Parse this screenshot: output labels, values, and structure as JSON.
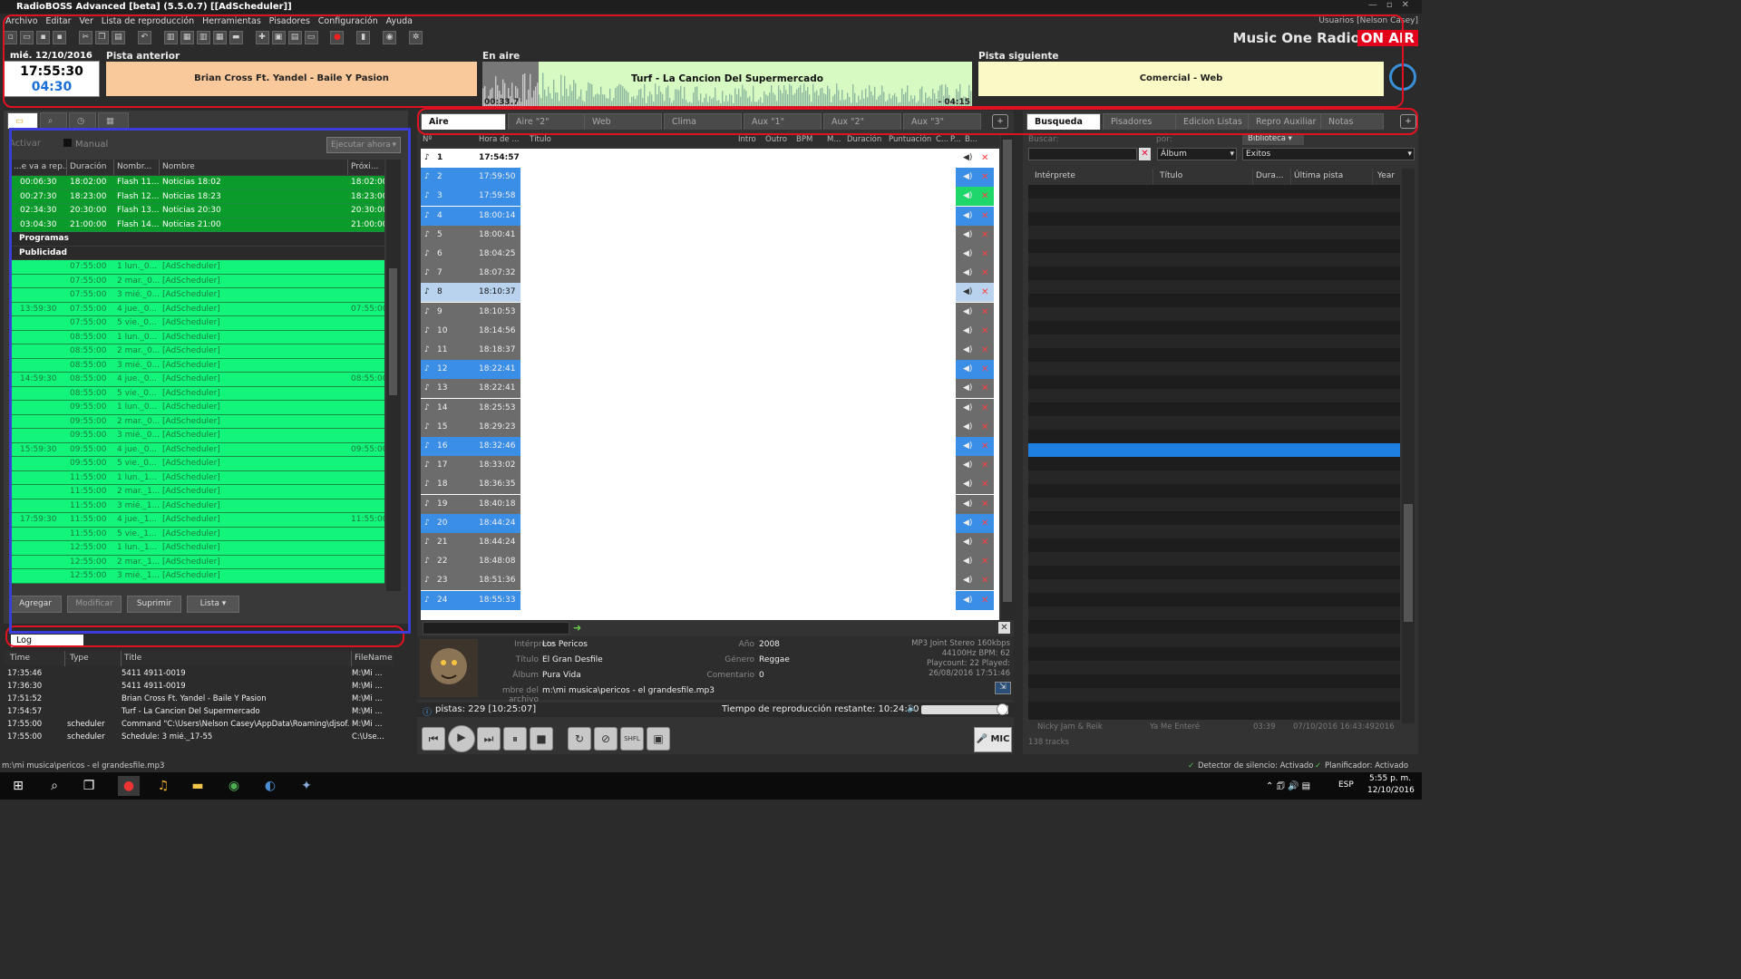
{
  "app": {
    "title": "RadioBOSS Advanced [beta] (5.5.0.7) [[AdScheduler]]",
    "users": "Usuarios [Nelson Casey]",
    "station_name": "Music One Radio",
    "on_air_label": "ON AIR"
  },
  "menu": [
    "Archivo",
    "Editar",
    "Ver",
    "Lista de reproducción",
    "Herramientas",
    "Pisadores",
    "Configuración",
    "Ayuda"
  ],
  "status": {
    "date": "mié. 12/10/2016",
    "time": "17:55:30",
    "countdown": "04:30",
    "prev_label": "Pista anterior",
    "prev_track": "Brian Cross Ft. Yandel - Baile Y Pasion",
    "onair_label": "En aire",
    "onair_track": "Turf - La Cancion Del Supermercado",
    "onair_elapsed": "00:33.7",
    "onair_remaining": "- 04:15",
    "next_label": "Pista siguiente",
    "next_track": "Comercial - Web"
  },
  "scheduler": {
    "activar": "Activar",
    "manual": "Manual",
    "run_now": "Ejecutar ahora",
    "columns": [
      "...e va a rep...",
      "Duración",
      "Nombr...",
      "Nombre",
      "Próxi..."
    ],
    "rows": [
      {
        "kind": "dark",
        "c1": "00:06:30",
        "c2": "18:02:00",
        "c3": "Flash 11...",
        "c4": "Noticias 18:02",
        "c5": "18:02:00"
      },
      {
        "kind": "dark",
        "c1": "00:27:30",
        "c2": "18:23:00",
        "c3": "Flash 12...",
        "c4": "Noticias 18:23",
        "c5": "18:23:00"
      },
      {
        "kind": "dark",
        "c1": "02:34:30",
        "c2": "20:30:00",
        "c3": "Flash 13...",
        "c4": "Noticias 20:30",
        "c5": "20:30:00"
      },
      {
        "kind": "dark",
        "c1": "03:04:30",
        "c2": "21:00:00",
        "c3": "Flash 14...",
        "c4": "Noticias 21:00",
        "c5": "21:00:00"
      },
      {
        "kind": "group",
        "c1": "Programas"
      },
      {
        "kind": "group",
        "c1": "Publicidad"
      },
      {
        "kind": "light",
        "c1": "",
        "c2": "07:55:00",
        "c3": "1 lun._0...",
        "c4": "[AdScheduler]",
        "c5": ""
      },
      {
        "kind": "light",
        "c1": "",
        "c2": "07:55:00",
        "c3": "2 mar._0...",
        "c4": "[AdScheduler]",
        "c5": ""
      },
      {
        "kind": "light",
        "c1": "",
        "c2": "07:55:00",
        "c3": "3 mié._0...",
        "c4": "[AdScheduler]",
        "c5": ""
      },
      {
        "kind": "light",
        "c1": "13:59:30",
        "c2": "07:55:00",
        "c3": "4 jue._0...",
        "c4": "[AdScheduler]",
        "c5": "07:55:00"
      },
      {
        "kind": "light",
        "c1": "",
        "c2": "07:55:00",
        "c3": "5 vie._0...",
        "c4": "[AdScheduler]",
        "c5": ""
      },
      {
        "kind": "light",
        "c1": "",
        "c2": "08:55:00",
        "c3": "1 lun._0...",
        "c4": "[AdScheduler]",
        "c5": ""
      },
      {
        "kind": "light",
        "c1": "",
        "c2": "08:55:00",
        "c3": "2 mar._0...",
        "c4": "[AdScheduler]",
        "c5": ""
      },
      {
        "kind": "light",
        "c1": "",
        "c2": "08:55:00",
        "c3": "3 mié._0...",
        "c4": "[AdScheduler]",
        "c5": ""
      },
      {
        "kind": "light",
        "c1": "14:59:30",
        "c2": "08:55:00",
        "c3": "4 jue._0...",
        "c4": "[AdScheduler]",
        "c5": "08:55:00"
      },
      {
        "kind": "light",
        "c1": "",
        "c2": "08:55:00",
        "c3": "5 vie._0...",
        "c4": "[AdScheduler]",
        "c5": ""
      },
      {
        "kind": "light",
        "c1": "",
        "c2": "09:55:00",
        "c3": "1 lun._0...",
        "c4": "[AdScheduler]",
        "c5": ""
      },
      {
        "kind": "light",
        "c1": "",
        "c2": "09:55:00",
        "c3": "2 mar._0...",
        "c4": "[AdScheduler]",
        "c5": ""
      },
      {
        "kind": "light",
        "c1": "",
        "c2": "09:55:00",
        "c3": "3 mié._0...",
        "c4": "[AdScheduler]",
        "c5": ""
      },
      {
        "kind": "light",
        "c1": "15:59:30",
        "c2": "09:55:00",
        "c3": "4 jue._0...",
        "c4": "[AdScheduler]",
        "c5": "09:55:00"
      },
      {
        "kind": "light",
        "c1": "",
        "c2": "09:55:00",
        "c3": "5 vie._0...",
        "c4": "[AdScheduler]",
        "c5": ""
      },
      {
        "kind": "light",
        "c1": "",
        "c2": "11:55:00",
        "c3": "1 lun._1...",
        "c4": "[AdScheduler]",
        "c5": ""
      },
      {
        "kind": "light",
        "c1": "",
        "c2": "11:55:00",
        "c3": "2 mar._1...",
        "c4": "[AdScheduler]",
        "c5": ""
      },
      {
        "kind": "light",
        "c1": "",
        "c2": "11:55:00",
        "c3": "3 mié._1...",
        "c4": "[AdScheduler]",
        "c5": ""
      },
      {
        "kind": "light",
        "c1": "17:59:30",
        "c2": "11:55:00",
        "c3": "4 jue._1...",
        "c4": "[AdScheduler]",
        "c5": "11:55:00"
      },
      {
        "kind": "light",
        "c1": "",
        "c2": "11:55:00",
        "c3": "5 vie._1...",
        "c4": "[AdScheduler]",
        "c5": ""
      },
      {
        "kind": "light",
        "c1": "",
        "c2": "12:55:00",
        "c3": "1 lun._1...",
        "c4": "[AdScheduler]",
        "c5": ""
      },
      {
        "kind": "light",
        "c1": "",
        "c2": "12:55:00",
        "c3": "2 mar._1...",
        "c4": "[AdScheduler]",
        "c5": ""
      },
      {
        "kind": "light",
        "c1": "",
        "c2": "12:55:00",
        "c3": "3 mié._1...",
        "c4": "[AdScheduler]",
        "c5": ""
      }
    ],
    "buttons": {
      "add": "Agregar",
      "modify": "Modificar",
      "delete": "Suprimir",
      "list": "Lista"
    }
  },
  "log": {
    "tab": "Log",
    "columns": [
      "Time",
      "Type",
      "Title",
      "FileName"
    ],
    "rows": [
      {
        "time": "17:35:46",
        "type": "",
        "title": "5411 4911-0019",
        "file": "M:\\Mi ..."
      },
      {
        "time": "17:36:30",
        "type": "",
        "title": "5411 4911-0019",
        "file": "M:\\Mi ..."
      },
      {
        "time": "17:51:52",
        "type": "",
        "title": "Brian Cross Ft. Yandel - Baile Y Pasion",
        "file": "M:\\Mi ..."
      },
      {
        "time": "17:54:57",
        "type": "",
        "title": "Turf - La Cancion Del Supermercado",
        "file": "M:\\Mi ..."
      },
      {
        "time": "17:55:00",
        "type": "scheduler",
        "title": "Command \"C:\\Users\\Nelson Casey\\AppData\\Roaming\\djsof...",
        "file": "M:\\Mi ..."
      },
      {
        "time": "17:55:00",
        "type": "scheduler",
        "title": "Schedule: 3 mié._17-55",
        "file": "C:\\Use..."
      }
    ]
  },
  "playlist": {
    "tabs": [
      "Aire",
      "Aire \"2\"",
      "Web",
      "Clima",
      "Aux \"1\"",
      "Aux \"2\"",
      "Aux \"3\""
    ],
    "columns": [
      "Nº",
      "Hora de ...",
      "Título",
      "Intro",
      "Outro",
      "BPM",
      "M...",
      "Duración",
      "Puntuación",
      "C...",
      "P...",
      "B..."
    ],
    "rows": [
      {
        "n": "1",
        "t": "17:54:57",
        "state": "playing"
      },
      {
        "n": "2",
        "t": "17:59:50",
        "state": "blue"
      },
      {
        "n": "3",
        "t": "17:59:58",
        "state": "green"
      },
      {
        "n": "4",
        "t": "18:00:14",
        "state": "blue"
      },
      {
        "n": "5",
        "t": "18:00:41",
        "state": "gray"
      },
      {
        "n": "6",
        "t": "18:04:25",
        "state": "gray"
      },
      {
        "n": "7",
        "t": "18:07:32",
        "state": "gray"
      },
      {
        "n": "8",
        "t": "18:10:37",
        "state": "selected"
      },
      {
        "n": "9",
        "t": "18:10:53",
        "state": "gray"
      },
      {
        "n": "10",
        "t": "18:14:56",
        "state": "gray"
      },
      {
        "n": "11",
        "t": "18:18:37",
        "state": "gray"
      },
      {
        "n": "12",
        "t": "18:22:41",
        "state": "blue"
      },
      {
        "n": "13",
        "t": "18:22:41",
        "state": "gray"
      },
      {
        "n": "14",
        "t": "18:25:53",
        "state": "gray"
      },
      {
        "n": "15",
        "t": "18:29:23",
        "state": "gray"
      },
      {
        "n": "16",
        "t": "18:32:46",
        "state": "blue"
      },
      {
        "n": "17",
        "t": "18:33:02",
        "state": "gray"
      },
      {
        "n": "18",
        "t": "18:36:35",
        "state": "gray"
      },
      {
        "n": "19",
        "t": "18:40:18",
        "state": "gray"
      },
      {
        "n": "20",
        "t": "18:44:24",
        "state": "blue"
      },
      {
        "n": "21",
        "t": "18:44:24",
        "state": "gray"
      },
      {
        "n": "22",
        "t": "18:48:08",
        "state": "gray"
      },
      {
        "n": "23",
        "t": "18:51:36",
        "state": "gray"
      },
      {
        "n": "24",
        "t": "18:55:33",
        "state": "blue"
      }
    ],
    "info": {
      "artist_label": "Intérprete",
      "artist": "Los Pericos",
      "title_label": "Título",
      "title": "El Gran Desfile",
      "album_label": "Álbum",
      "album": "Pura Vida",
      "file_label": "mbre del archivo",
      "file": "m:\\mi musica\\pericos - el grandesfile.mp3",
      "year_label": "Año",
      "year": "2008",
      "genre_label": "Género",
      "genre": "Reggae",
      "comment_label": "Comentario",
      "comment": "0",
      "tech1": "MP3 Joint Stereo 160kbps",
      "tech2": "44100Hz BPM: 62",
      "tech3": "Playcount: 22  Played:",
      "tech4": "26/08/2016 17:51:46"
    },
    "tracks": "pistas: 229 [10:25:07]",
    "remaining": "Tiempo de reproducción restante: 10:24:30",
    "mic": "MIC"
  },
  "right": {
    "tabs": [
      "Busqueda",
      "Pisadores",
      "Edicion Listas",
      "Repro Auxiliar",
      "Notas"
    ],
    "search_label": "Buscar:",
    "by_label": "por:",
    "by_value": "Álbum",
    "library": "Biblioteca",
    "library_value": "Exitos",
    "columns": [
      "Intérprete",
      "Título",
      "Dura...",
      "Última pista",
      "Year"
    ],
    "footer_row": {
      "artist": "Nicky Jam & Reik",
      "title": "Ya Me Enteré",
      "dur": "03:39",
      "last": "07/10/2016 16:43:49",
      "year": "2016"
    },
    "count": "138 tracks"
  },
  "statusbar": {
    "file": "m:\\mi musica\\pericos - el grandesfile.mp3",
    "silence": "Detector de silencio: Activado",
    "planner": "Planificador: Activado"
  },
  "taskbar": {
    "lang": "ESP",
    "time": "5:55 p. m.",
    "date": "12/10/2016"
  }
}
